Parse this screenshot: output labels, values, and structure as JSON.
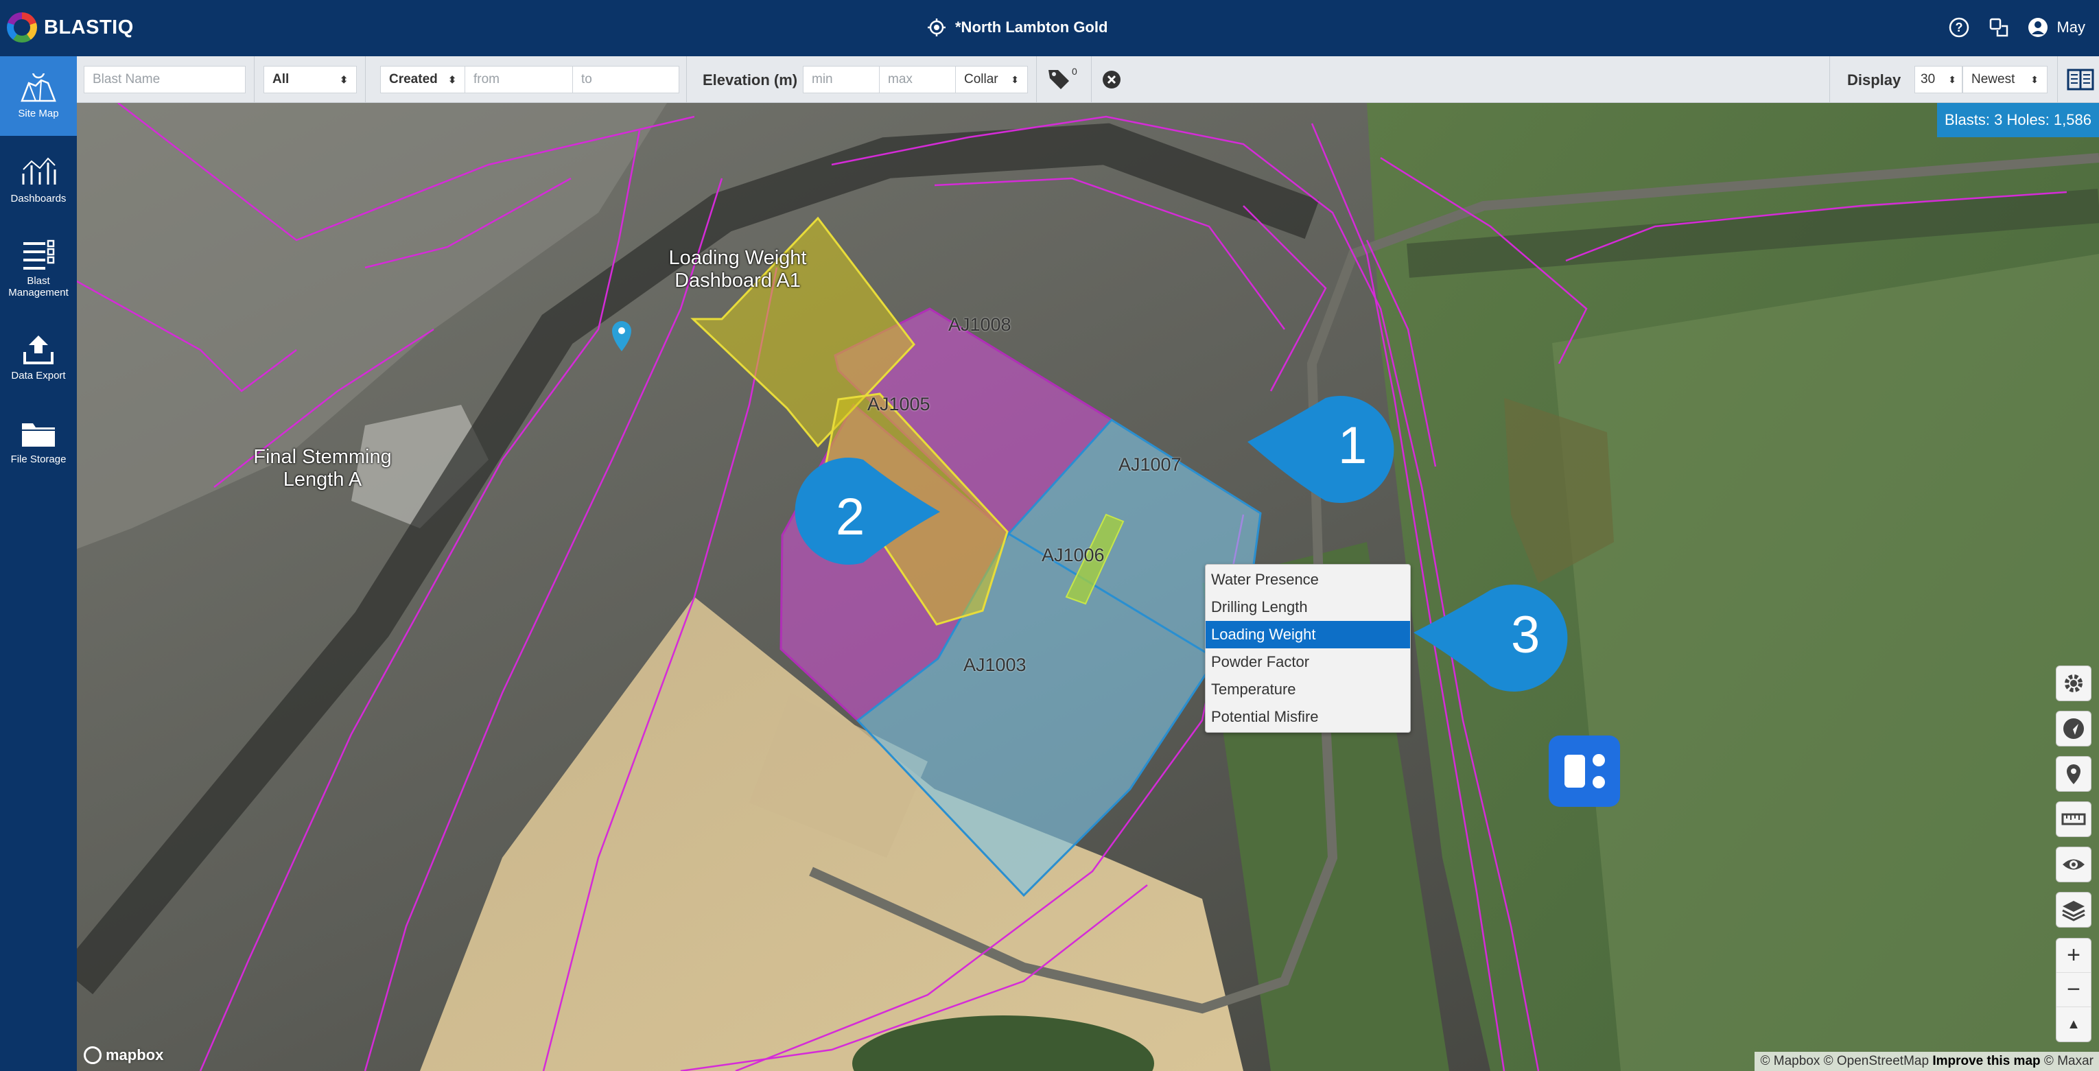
{
  "header": {
    "logo_text": "BLASTIQ",
    "site_name": "*North Lambton Gold",
    "user_name": "May",
    "icons": [
      "help-icon",
      "switch-icon",
      "user-icon"
    ]
  },
  "sidebar": {
    "items": [
      {
        "label": "Site Map",
        "icon": "map-icon",
        "active": true
      },
      {
        "label": "Dashboards",
        "icon": "chart-icon"
      },
      {
        "label": "Blast Management",
        "icon": "list-icon"
      },
      {
        "label": "Data Export",
        "icon": "upload-icon"
      },
      {
        "label": "File Storage",
        "icon": "folder-icon"
      }
    ]
  },
  "filters": {
    "blast_name_placeholder": "Blast Name",
    "status_value": "All",
    "date_type_value": "Created",
    "from_placeholder": "from",
    "to_placeholder": "to",
    "elevation_label": "Elevation (m)",
    "min_placeholder": "min",
    "max_placeholder": "max",
    "elevation_ref_value": "Collar",
    "tag_count": "0",
    "display_label": "Display",
    "display_count_value": "30",
    "sort_value": "Newest"
  },
  "map": {
    "summary": "Blasts: 3 Holes: 1,586",
    "region_labels": {
      "final_stemming": "Final Stemming Length A",
      "loading_weight_dashboard": "Loading Weight Dashboard A1"
    },
    "blasts": [
      "AJ1008",
      "AJ1005",
      "AJ1007",
      "AJ1006",
      "AJ1003"
    ],
    "callouts": [
      "1",
      "2",
      "3"
    ],
    "context_menu": {
      "items": [
        "Water Presence",
        "Drilling Length",
        "Loading Weight",
        "Powder Factor",
        "Temperature",
        "Potential Misfire"
      ],
      "selected": "Loading Weight"
    },
    "controls": [
      "settings-icon",
      "navigate-icon",
      "pin-icon",
      "ruler-icon",
      "eye-icon",
      "layers-icon"
    ],
    "zoom": {
      "in": "+",
      "out": "−",
      "north": "▲"
    },
    "mapbox_logo": "mapbox",
    "attribution": {
      "text": "© Mapbox © OpenStreetMap",
      "improve": "Improve this map",
      "maxar": "© Maxar"
    }
  },
  "colors": {
    "header_bg": "#0b3468",
    "active_nav": "#2f7fd4",
    "selected_menu": "#0d6fc7",
    "callout": "#1a8ad4",
    "blast_yellow": "#d4c51c",
    "blast_magenta": "#d44fd8",
    "blast_blue": "#7fc5e6"
  }
}
